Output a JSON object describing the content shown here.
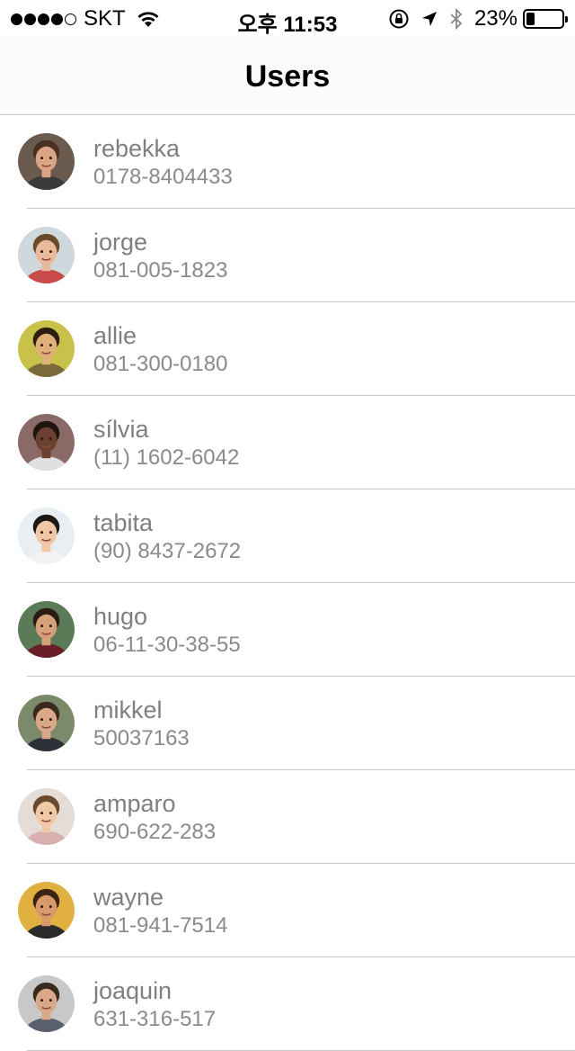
{
  "status_bar": {
    "carrier": "SKT",
    "time": "오후 11:53",
    "battery_percent": "23%",
    "battery_level": 0.23,
    "icons": [
      "signal-dots-icon",
      "wifi-icon",
      "rotation-lock-icon",
      "location-arrow-icon",
      "bluetooth-icon",
      "battery-icon"
    ]
  },
  "nav": {
    "title": "Users"
  },
  "users": [
    {
      "name": "rebekka",
      "phone": "0178-8404433",
      "bg": "#6b5a4e",
      "skin": "#d9a585",
      "hair": "#4a3020",
      "shirt": "#3a3a3a"
    },
    {
      "name": "jorge",
      "phone": "081-005-1823",
      "bg": "#cfd8dc",
      "skin": "#e8b99a",
      "hair": "#6b4a2a",
      "shirt": "#c84a4a"
    },
    {
      "name": "allie",
      "phone": "081-300-0180",
      "bg": "#c9c24a",
      "skin": "#e0b07a",
      "hair": "#2e1e12",
      "shirt": "#7a6a3a"
    },
    {
      "name": "sílvia",
      "phone": "(11) 1602-6042",
      "bg": "#8a6a66",
      "skin": "#6b4030",
      "hair": "#1e140e",
      "shirt": "#e0e0e0"
    },
    {
      "name": "tabita",
      "phone": "(90) 8437-2672",
      "bg": "#e8eef2",
      "skin": "#f0c8a6",
      "hair": "#1e1812",
      "shirt": "#f2f2f2"
    },
    {
      "name": "hugo",
      "phone": "06-11-30-38-55",
      "bg": "#5a7a58",
      "skin": "#d6a07a",
      "hair": "#2a1a12",
      "shirt": "#6a1e28"
    },
    {
      "name": "mikkel",
      "phone": "50037163",
      "bg": "#7a8a6a",
      "skin": "#d8a888",
      "hair": "#3a2a1e",
      "shirt": "#2e3238"
    },
    {
      "name": "amparo",
      "phone": "690-622-283",
      "bg": "#e6dcd6",
      "skin": "#f0caa8",
      "hair": "#6a4a2e",
      "shirt": "#d8b0b0"
    },
    {
      "name": "wayne",
      "phone": "081-941-7514",
      "bg": "#e0b040",
      "skin": "#d89a6a",
      "hair": "#3a2412",
      "shirt": "#2a2a2a"
    },
    {
      "name": "joaquin",
      "phone": "631-316-517",
      "bg": "#c8c8c8",
      "skin": "#d8a888",
      "hair": "#3a2a1e",
      "shirt": "#5a6070"
    }
  ]
}
